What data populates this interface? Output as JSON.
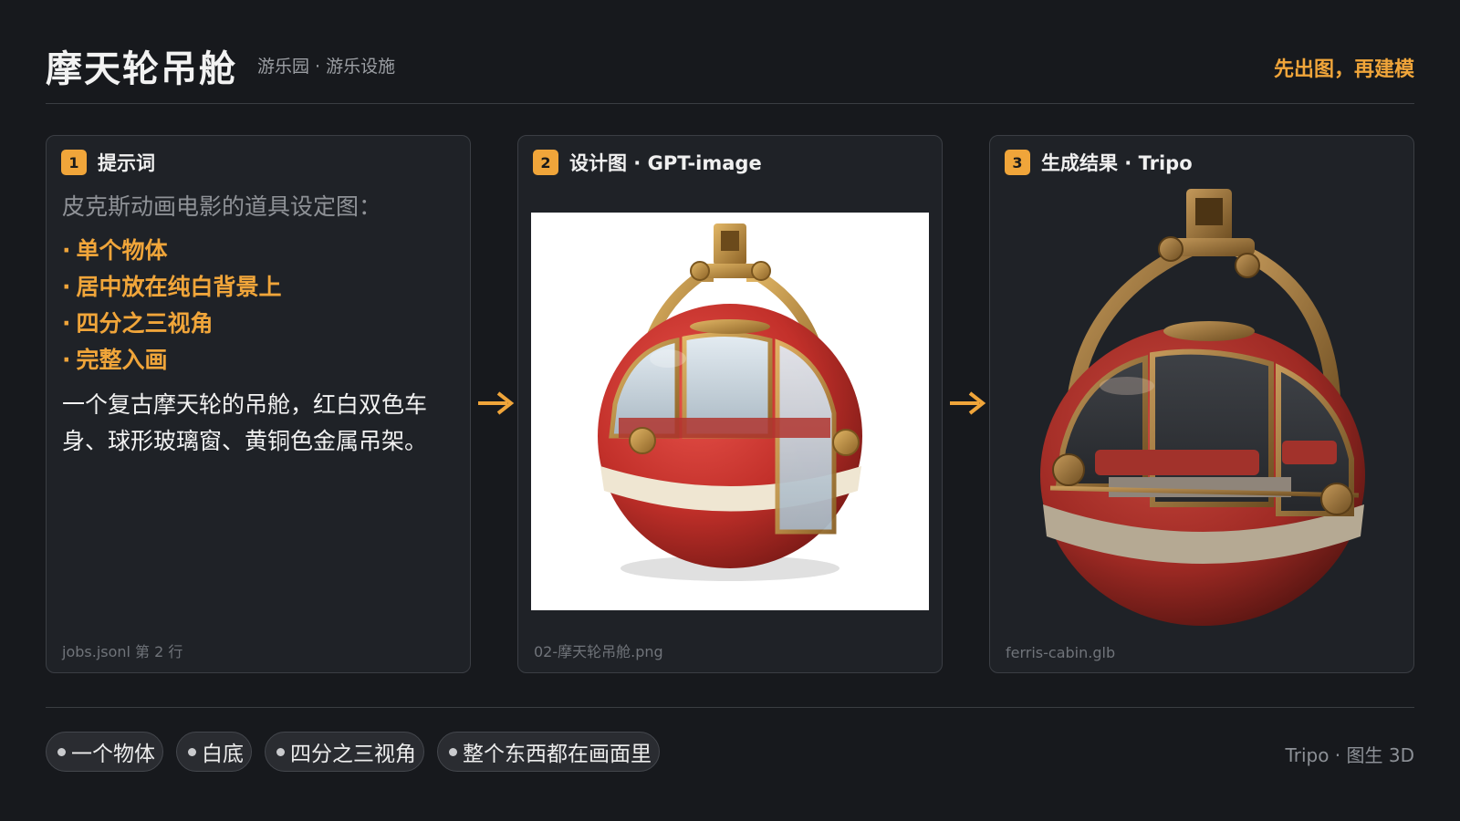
{
  "header": {
    "title": "摩天轮吊舱",
    "subtitle": "游乐园 · 游乐设施",
    "tagline": "先出图，再建模"
  },
  "cards": [
    {
      "number": "1",
      "title": "提示词",
      "intro": "皮克斯动画电影的道具设定图：",
      "bullets": [
        "单个物体",
        "居中放在纯白背景上",
        "四分之三视角",
        "完整入画"
      ],
      "body": "一个复古摩天轮的吊舱，红白双色车身、球形玻璃窗、黄铜色金属吊架。",
      "footer": "jobs.jsonl 第 2 行"
    },
    {
      "number": "2",
      "title": "设计图 · GPT-image",
      "footer": "02-摩天轮吊舱.png"
    },
    {
      "number": "3",
      "title": "生成结果 · Tripo",
      "footer": "ferris-cabin.glb"
    }
  ],
  "tags": [
    "一个物体",
    "白底",
    "四分之三视角",
    "整个东西都在画面里"
  ],
  "footer_right": "Tripo · 图生 3D",
  "colors": {
    "accent": "#f0a53a",
    "background": "#17191d",
    "card": "#1f2227",
    "cabin_red": "#c8332c",
    "cabin_cream": "#efe6d2",
    "brass": "#b8893d"
  }
}
